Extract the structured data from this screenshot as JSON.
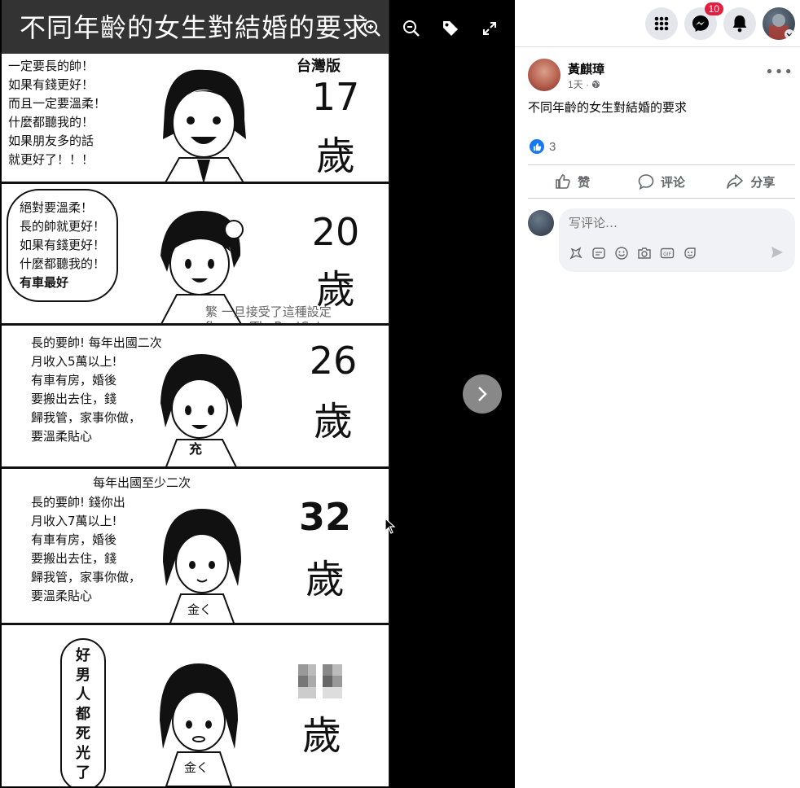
{
  "comic": {
    "title": "不同年齡的女生對結婚的要求",
    "panels": [
      {
        "lines": [
          "一定要長的帥！",
          "如果有錢更好！",
          "而且一定要溫柔！",
          "什麼都聽我的！",
          "如果朋友多的話",
          "就更好了！！！"
        ],
        "badge": "台灣版",
        "age": "17",
        "unit": "歲"
      },
      {
        "lines": [
          "絕對要溫柔！",
          "長的帥就更好！",
          "如果有錢更好！",
          "什麼都聽我的！",
          "有車最好"
        ],
        "age": "20",
        "unit": "歲",
        "watermark1": "繁 一旦接受了這種設定",
        "watermark2": "fb.com/TheBestSet"
      },
      {
        "lines": [
          "長的要帥! 每年出國二次",
          "月收入5萬以上!",
          "有車有房，婚後",
          "要搬出去住，錢",
          "歸我管，家事你做，",
          "要溫柔貼心"
        ],
        "age": "26",
        "unit": "歲",
        "shirt": "充"
      },
      {
        "top": "每年出國至少二次",
        "lines": [
          "長的要帥! 錢你出",
          "月收入7萬以上!",
          "有車有房，婚後",
          "要搬出去住，錢",
          "歸我管，家事你做，",
          "要溫柔貼心"
        ],
        "age": "32",
        "unit": "歲",
        "shirt": "金く"
      },
      {
        "lines": [
          "好",
          "男",
          "人",
          "都",
          "死",
          "光",
          "了"
        ],
        "unit": "歲",
        "shirt": "金く"
      }
    ]
  },
  "viewer_tools": [
    "zoom-in",
    "zoom-out",
    "tag",
    "fullscreen"
  ],
  "topbar": {
    "messenger_badge": "10"
  },
  "post": {
    "author": "黃麒璋",
    "time": "1天 · ",
    "text": "不同年齡的女生對結婚的要求",
    "reaction_count": "3",
    "actions": {
      "like": "赞",
      "comment": "评论",
      "share": "分享"
    },
    "comment_placeholder": "写评论…"
  },
  "colors": {
    "brand": "#1877f2",
    "badge": "#e41e3f"
  }
}
